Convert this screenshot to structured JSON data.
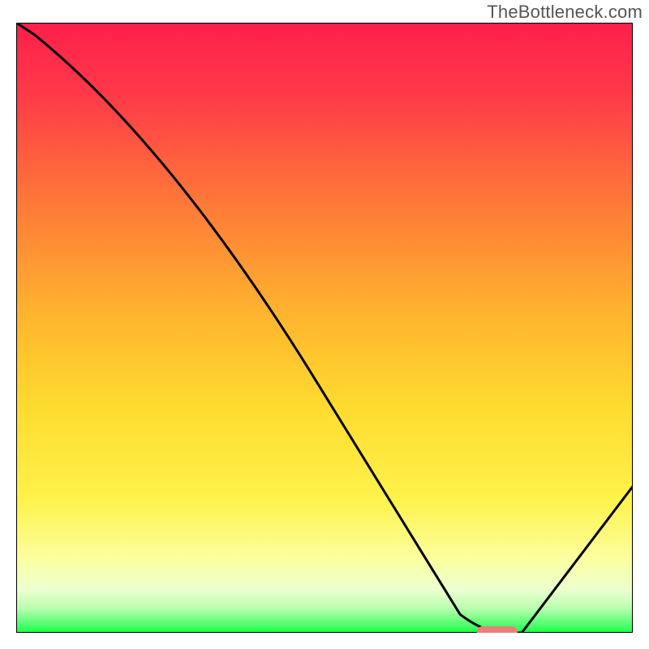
{
  "watermark": "TheBottleneck.com",
  "chart_data": {
    "type": "line",
    "title": "",
    "xlabel": "",
    "ylabel": "",
    "xlim": [
      0,
      100
    ],
    "ylim": [
      0,
      100
    ],
    "x": [
      0,
      3,
      25,
      72,
      76,
      82,
      100
    ],
    "values": [
      100,
      98,
      80,
      3,
      0,
      0,
      24
    ],
    "notes": "Bottleneck percentage vs. some parameter. Curve descends from top-left, flattens near 0 around x≈76–82 (green region), then rises toward the right.",
    "gradient_colors": {
      "top": "#ff2e4d",
      "upper_mid": "#ff9a2a",
      "mid": "#ffe030",
      "lower_mid": "#f7ff6a",
      "green": "#1cff4a"
    },
    "marker": {
      "x": 78,
      "y": 0,
      "shape": "pill",
      "color": "#e9817b"
    }
  }
}
